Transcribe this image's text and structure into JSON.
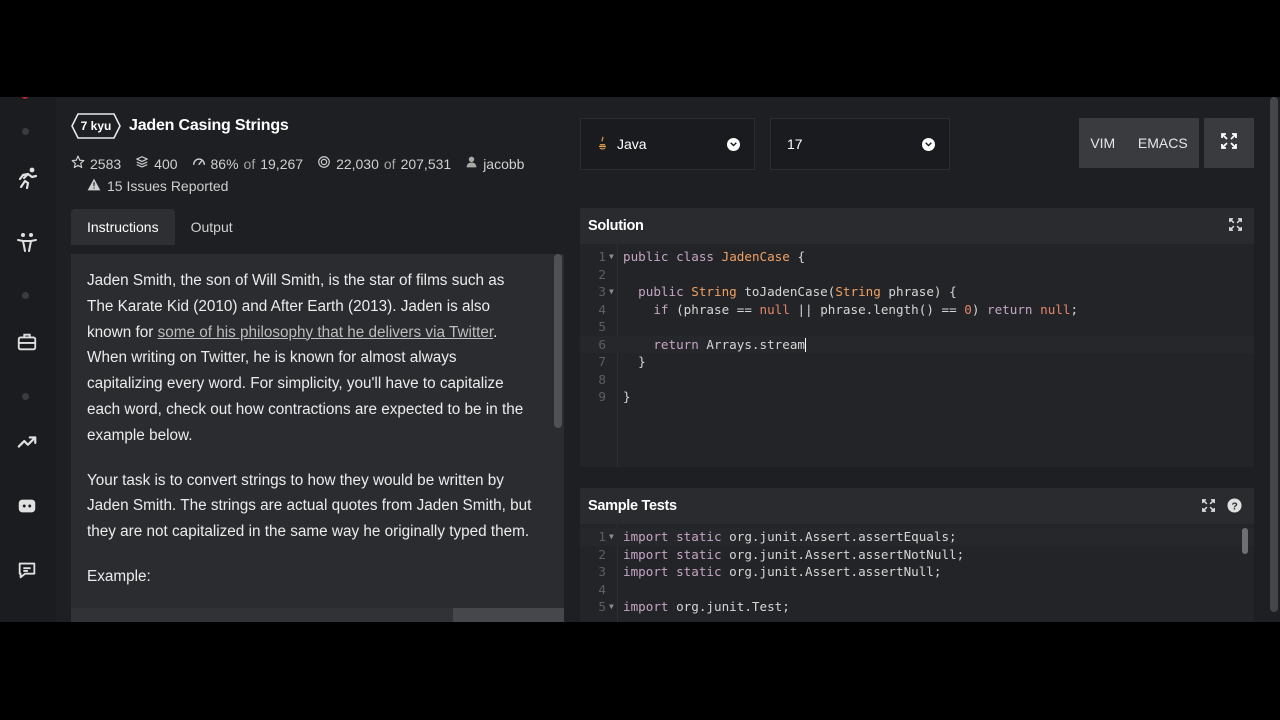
{
  "kata": {
    "rank": "7 kyu",
    "title": "Jaden Casing Strings",
    "stars": "2583",
    "collections": "400",
    "satisfaction": "86%",
    "satisfaction_of": "of",
    "votes": "19,267",
    "completed": "22,030",
    "completed_of": "of",
    "attempts": "207,531",
    "author": "jacobb",
    "issues": "15 Issues Reported"
  },
  "tabs": {
    "instructions": "Instructions",
    "output": "Output"
  },
  "description": {
    "p1_before": "Jaden Smith, the son of Will Smith, is the star of films such as The Karate Kid (2010) and After Earth (2013). Jaden is also known for ",
    "p1_link": "some of his philosophy that he delivers via Twitter",
    "p1_after": ". When writing on Twitter, he is known for almost always capitalizing every word. For simplicity, you'll have to capitalize each word, check out how contractions are expected to be in the example below.",
    "p2": "Your task is to convert strings to how they would be written by Jaden Smith. The strings are actual quotes from Jaden Smith, but they are not capitalized in the same way he originally typed them.",
    "p3": "Example:"
  },
  "toolbar": {
    "language": "Java",
    "version": "17",
    "vim": "VIM",
    "emacs": "EMACS"
  },
  "solution": {
    "title": "Solution",
    "lines": [
      "1",
      "2",
      "3",
      "4",
      "5",
      "6",
      "7",
      "8",
      "9"
    ]
  },
  "tests": {
    "title": "Sample Tests",
    "lines": [
      "1",
      "2",
      "3",
      "4",
      "5"
    ]
  },
  "colors": {
    "accent": "#b12a2a",
    "background": "#1e1f22",
    "panel": "#2b2c30"
  },
  "icons": [
    "star-icon",
    "stack-icon",
    "chart-icon",
    "target-icon",
    "user-icon",
    "warning-icon",
    "expand-icon",
    "help-icon",
    "chevron-down-icon"
  ]
}
